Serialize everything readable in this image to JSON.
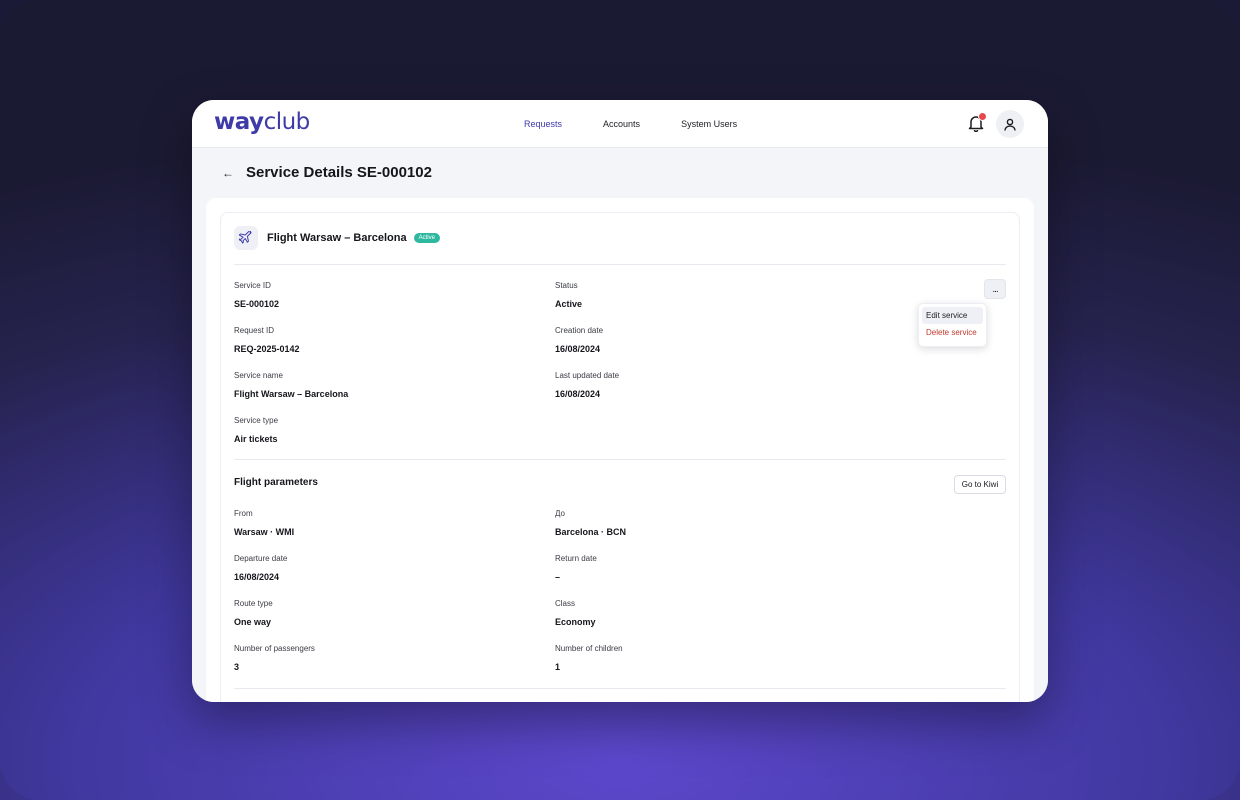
{
  "app": {
    "logo_way": "way",
    "logo_club": "club"
  },
  "nav": {
    "items": [
      {
        "label": "Requests",
        "active": true
      },
      {
        "label": "Accounts",
        "active": false
      },
      {
        "label": "System Users",
        "active": false
      }
    ]
  },
  "header": {
    "back_icon": "arrow-left-icon",
    "title": "Service Details SE-000102"
  },
  "card": {
    "icon": "plane-icon",
    "title": "Flight Warsaw – Barcelona",
    "badge": "Active"
  },
  "details": {
    "service_id_label": "Service ID",
    "service_id": "SE-000102",
    "status_label": "Status",
    "status": "Active",
    "request_id_label": "Request ID",
    "request_id": "REQ-2025-0142",
    "creation_date_label": "Creation date",
    "creation_date": "16/08/2024",
    "service_name_label": "Service name",
    "service_name": "Flight Warsaw – Barcelona",
    "last_updated_label": "Last updated date",
    "last_updated": "16/08/2024",
    "service_type_label": "Service type",
    "service_type": "Air tickets"
  },
  "actions_menu": {
    "trigger": "...",
    "edit": "Edit service",
    "delete": "Delete service"
  },
  "flight": {
    "section_title": "Flight parameters",
    "go_button": "Go to Kiwi",
    "from_label": "From",
    "from": "Warsaw · WMI",
    "to_label": "До",
    "to": "Barcelona · BCN",
    "departure_label": "Departure date",
    "departure": "16/08/2024",
    "return_label": "Return date",
    "return": "–",
    "route_type_label": "Route type",
    "route_type": "One way",
    "class_label": "Class",
    "class": "Economy",
    "passengers_label": "Number of passengers",
    "passengers": "3",
    "children_label": "Number of children",
    "children": "1"
  },
  "colors": {
    "brand": "#3e3aa8",
    "badge": "#2fb8a0",
    "danger": "#c0392b",
    "notification": "#e5484d"
  }
}
